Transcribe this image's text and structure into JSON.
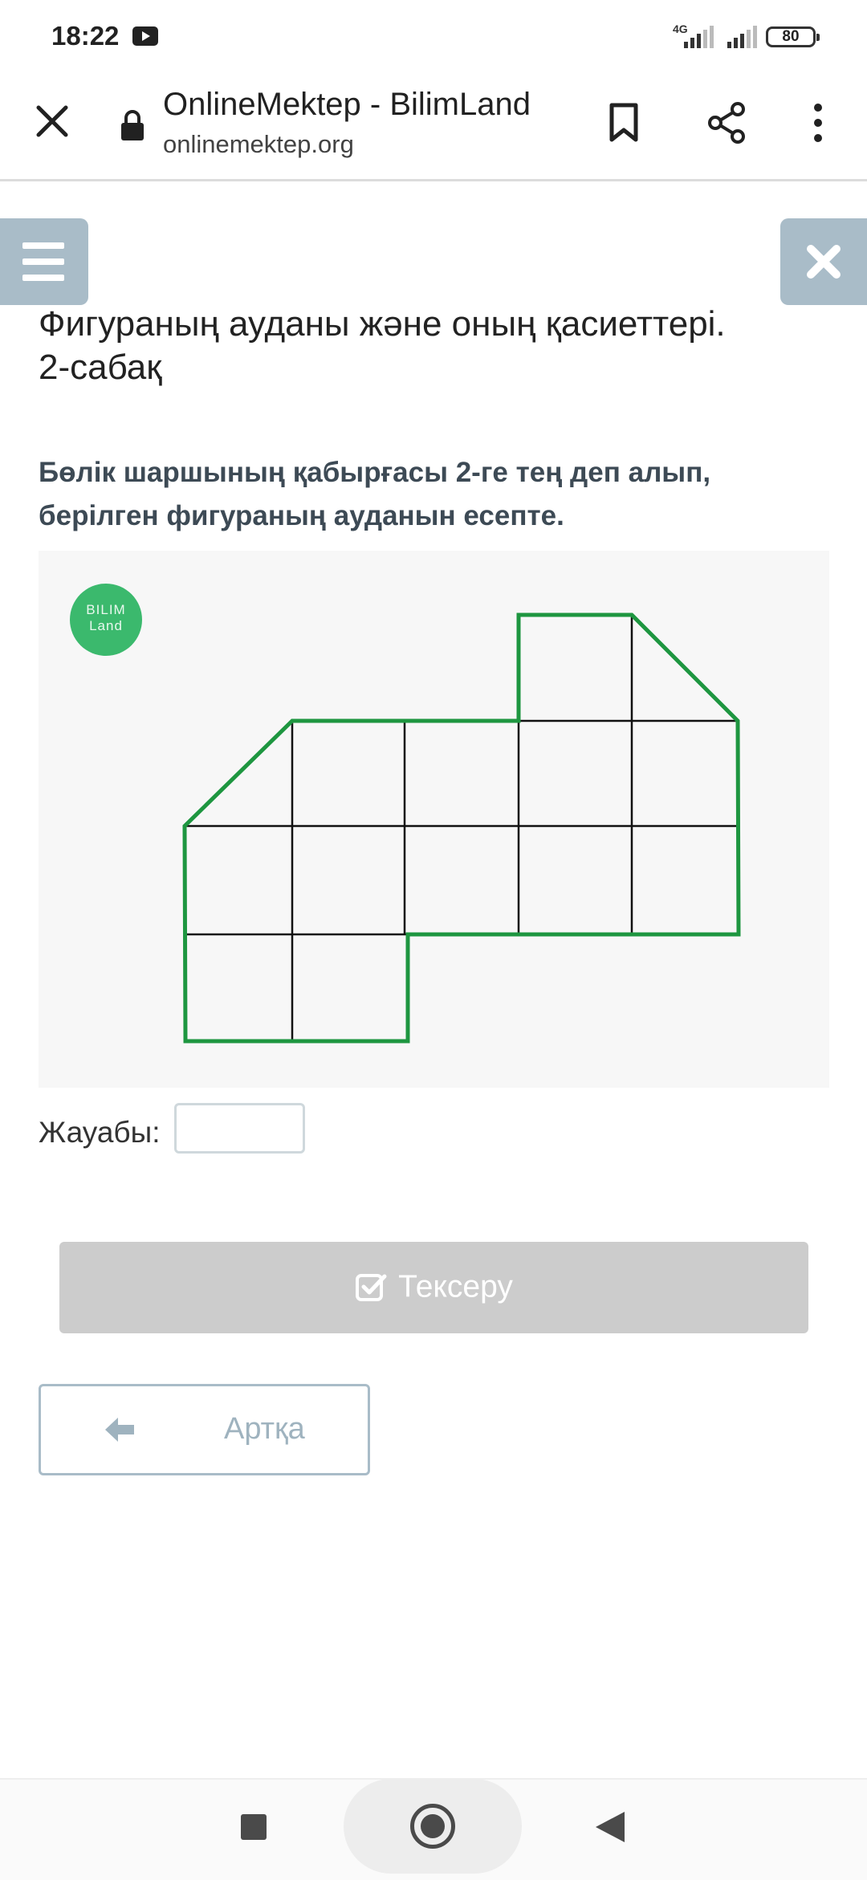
{
  "status_bar": {
    "time": "18:22",
    "network": "4G",
    "battery": "80",
    "notification_icon": "youtube-icon"
  },
  "browser": {
    "site_title": "OnlineMektep - BilimLand",
    "url": "onlinemektep.org",
    "icons": [
      "close-icon",
      "lock-icon",
      "bookmark-icon",
      "share-icon",
      "more-vert-icon"
    ]
  },
  "lesson": {
    "title": "Фигураның ауданы және оның қасиеттері. 2-сабақ",
    "task": "Бөлік шаршының қабырғасы 2-ге тең деп алып, берілген фигураның ауданын есепте.",
    "logo_line1": "BILIM",
    "logo_line2": "Land",
    "answer_label": "Жауабы:",
    "answer_value": "",
    "check_button": "Тексеру",
    "back_button": "Артқа"
  },
  "colors": {
    "accent": "#a9bcc8",
    "shape_outline": "#1e9640",
    "logo": "#3bb96d",
    "check_disabled": "#cccccc"
  }
}
